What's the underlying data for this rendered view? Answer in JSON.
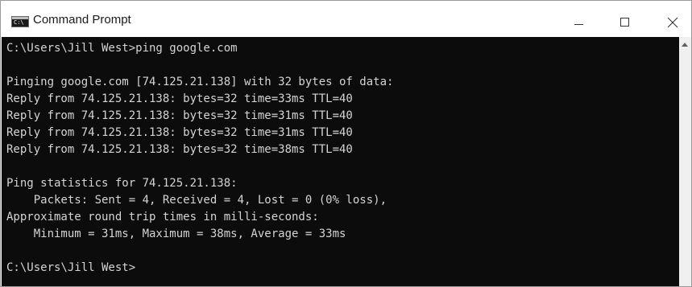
{
  "window": {
    "title": "Command Prompt",
    "app_icon": "cmd-icon",
    "app_icon_glyph": "C:\\",
    "controls": {
      "minimize_icon": "minimize-icon",
      "maximize_icon": "maximize-icon",
      "close_icon": "close-icon"
    }
  },
  "console": {
    "background": "#0c0c0c",
    "foreground": "#d4d4d4",
    "lines": [
      "C:\\Users\\Jill West>ping google.com",
      "",
      "Pinging google.com [74.125.21.138] with 32 bytes of data:",
      "Reply from 74.125.21.138: bytes=32 time=33ms TTL=40",
      "Reply from 74.125.21.138: bytes=32 time=31ms TTL=40",
      "Reply from 74.125.21.138: bytes=32 time=31ms TTL=40",
      "Reply from 74.125.21.138: bytes=32 time=38ms TTL=40",
      "",
      "Ping statistics for 74.125.21.138:",
      "    Packets: Sent = 4, Received = 4, Lost = 0 (0% loss),",
      "Approximate round trip times in milli-seconds:",
      "    Minimum = 31ms, Maximum = 38ms, Average = 33ms",
      "",
      "C:\\Users\\Jill West>"
    ]
  },
  "scrollbar": {
    "up_arrow_icon": "scroll-up-icon"
  }
}
